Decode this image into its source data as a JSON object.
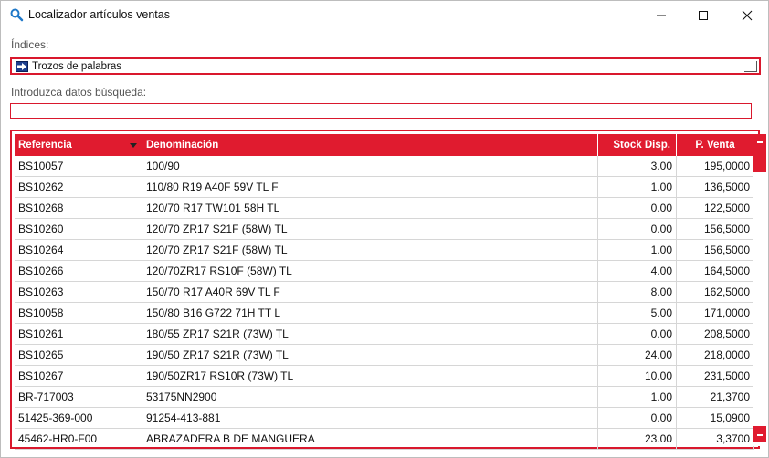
{
  "window": {
    "title": "Localizador artículos ventas",
    "icon": "search-icon",
    "controls": {
      "minimize": "—",
      "maximize": "☐",
      "close": "✕"
    }
  },
  "indices": {
    "label": "Índices:",
    "value": "Trozos de palabras"
  },
  "search": {
    "label": "Introduzca datos búsqueda:",
    "value": "",
    "placeholder": ""
  },
  "grid": {
    "columns": [
      "Referencia",
      "Denominación",
      "Stock Disp.",
      "P. Venta"
    ],
    "rows": [
      [
        "BS10057",
        "100/90",
        "3.00",
        "195,0000"
      ],
      [
        "BS10262",
        "110/80 R19 A40F 59V TL F",
        "1.00",
        "136,5000"
      ],
      [
        "BS10268",
        "120/70 R17 TW101 58H TL",
        "0.00",
        "122,5000"
      ],
      [
        "BS10260",
        "120/70 ZR17 S21F (58W) TL",
        "0.00",
        "156,5000"
      ],
      [
        "BS10264",
        "120/70 ZR17 S21F (58W) TL",
        "1.00",
        "156,5000"
      ],
      [
        "BS10266",
        "120/70ZR17 RS10F (58W) TL",
        "4.00",
        "164,5000"
      ],
      [
        "BS10263",
        "150/70 R17 A40R 69V TL F",
        "8.00",
        "162,5000"
      ],
      [
        "BS10058",
        "150/80 B16 G722 71H TT L",
        "5.00",
        "171,0000"
      ],
      [
        "BS10261",
        "180/55 ZR17 S21R (73W) TL",
        "0.00",
        "208,5000"
      ],
      [
        "BS10265",
        "190/50 ZR17 S21R (73W) TL",
        "24.00",
        "218,0000"
      ],
      [
        "BS10267",
        "190/50ZR17 RS10R (73W) TL",
        "10.00",
        "231,5000"
      ],
      [
        "BR-717003",
        "53175NN2900",
        "1.00",
        "21,3700"
      ],
      [
        "51425-369-000",
        "91254-413-881",
        "0.00",
        "15,0900"
      ],
      [
        "45462-HR0-F00",
        "ABRAZADERA B DE MANGUERA",
        "23.00",
        "3,3700"
      ]
    ]
  },
  "colors": {
    "accent": "#e01b2f",
    "border": "#d9182d",
    "icon_blue": "#1f78c8"
  }
}
